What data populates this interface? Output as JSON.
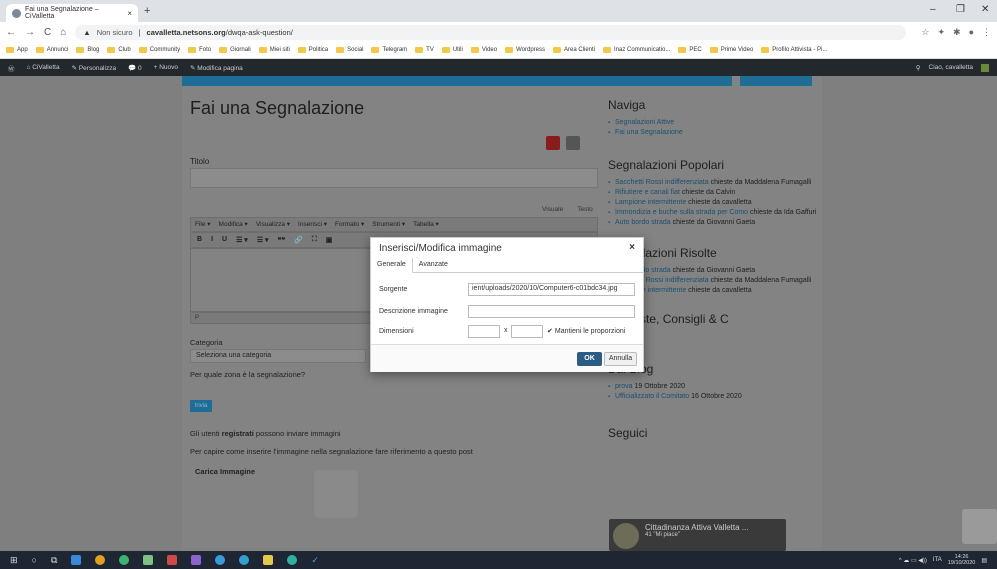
{
  "browser": {
    "tab_title": "Fai una Segnalazione – CiValletta",
    "tab_close": "×",
    "new_tab": "+",
    "win_min": "–",
    "win_max": "❐",
    "win_close": "✕",
    "nav_back": "←",
    "nav_forward": "→",
    "nav_reload": "C",
    "nav_home": "⌂",
    "insecure_label": "Non sicuro",
    "url_domain": "cavalletta.netsons.org",
    "url_path": "/dwqa-ask-question/",
    "star": "☆",
    "bookmarks": [
      "App",
      "Annunci",
      "Blog",
      "Club",
      "Community",
      "Foto",
      "Giornali",
      "Miei siti",
      "Politica",
      "Social",
      "Telegram",
      "TV",
      "Utili",
      "Video",
      "Wordpress",
      "Area Clienti",
      "Inaz Communicatio...",
      "PEC",
      "Prime Video",
      "Profilo Attivista - Pi..."
    ]
  },
  "adminbar": {
    "site": "CiValletta",
    "customize": "Personalizza",
    "comments": "0",
    "new": "Nuovo",
    "edit": "Modifica pagina",
    "greeting": "Ciao, cavalletta"
  },
  "main": {
    "title": "Fai una Segnalazione",
    "titolo_label": "Titolo",
    "editor_tab_visual": "Visuale",
    "editor_tab_text": "Testo",
    "menubar": [
      "File ▾",
      "Modifica ▾",
      "Visualizza ▾",
      "Inserisci ▾",
      "Formato ▾",
      "Strumenti ▾",
      "Tabella ▾"
    ],
    "toolbar": [
      "B",
      "I",
      "U",
      "☰ ▾",
      "☰ ▾",
      "❝❝",
      "🔗",
      "⛶",
      "▣"
    ],
    "status_p": "P",
    "category_label": "Categoria",
    "category_select": "Seleziona una categoria",
    "zona_label": "Per quale zona è la segnalazione?",
    "submit": "Invia",
    "users_prefix": "Gli utenti",
    "users_bold": "registrati",
    "users_suffix": "possono inviare immagini",
    "how_to": "Per capire come inserire l'immagine nella segnalazione fare riferimento a questo post",
    "upload_heading": "Carica Immagine"
  },
  "sidebar": {
    "naviga_title": "Naviga",
    "naviga_items": [
      "Segnalazioni Attive",
      "Fai una Segnalazione"
    ],
    "popolari_title": "Segnalazioni Popolari",
    "popolari_items": [
      {
        "link": "Sacchetti Rossi indifferenziata",
        "text": " chieste da Maddalena Fumagalli"
      },
      {
        "link": "Rifiutiere e canali fiat",
        "text": " chieste da Calvin"
      },
      {
        "link": "Lampione intermittente",
        "text": " chieste da cavalletta"
      },
      {
        "link": "Immondizia e buche sulla strada per Como",
        "text": " chieste da Ida Gaffuri"
      },
      {
        "link": "Auto bordo strada",
        "text": " chieste da Giovanni Gaeta"
      }
    ],
    "risolte_title": "Segnalazioni Risolte",
    "risolte_items": [
      {
        "link": "Auto bordo strada",
        "text": " chieste da Giovanni Gaeta"
      },
      {
        "link": "Sacchetti Rossi indifferenziata",
        "text": " chieste da Maddalena Fumagalli"
      },
      {
        "link": "Lampione intermittente",
        "text": " chieste da cavalletta"
      }
    ],
    "proposte_title": "Proposte, Consigli & C",
    "proposte_items": [
      "Proposte"
    ],
    "blog_title": "Dal Blog",
    "blog_items": [
      {
        "link": "prova",
        "text": " 19 Ottobre 2020"
      },
      {
        "link": "Ufficializzato il Comitato",
        "text": " 16 Ottobre 2020"
      }
    ],
    "seguici_title": "Seguici",
    "fb_name": "Cittadinanza Attiva Valletta ...",
    "fb_likes": "41 \"Mi piace\""
  },
  "modal": {
    "title": "Inserisci/Modifica immagine",
    "close": "×",
    "tab_general": "Generale",
    "tab_advanced": "Avanzate",
    "source_label": "Sorgente",
    "source_value": "ient/uploads/2020/10/Computer6-c01bdc34.jpg",
    "desc_label": "Descrizione immagine",
    "desc_value": "",
    "dim_label": "Dimensioni",
    "dim_x": "x",
    "keep_ratio": "Mantieni le proporzioni",
    "ok": "OK",
    "cancel": "Annulla"
  },
  "taskbar": {
    "lang": "ITA",
    "time": "14:26",
    "date": "19/10/2020"
  }
}
